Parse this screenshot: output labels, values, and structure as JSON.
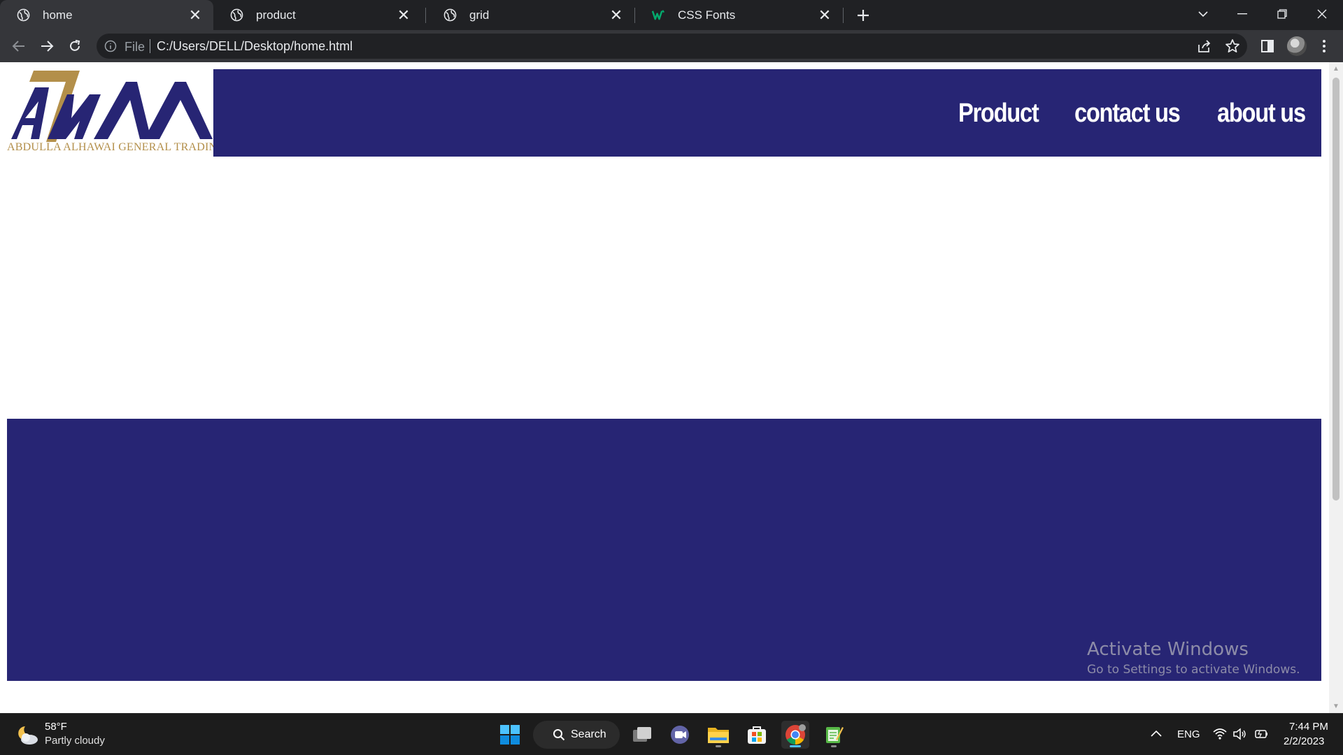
{
  "browser": {
    "tabs": [
      {
        "title": "home",
        "active": true,
        "icon": "globe-icon"
      },
      {
        "title": "product",
        "active": false,
        "icon": "globe-icon"
      },
      {
        "title": "grid",
        "active": false,
        "icon": "globe-icon"
      },
      {
        "title": "CSS Fonts",
        "active": false,
        "icon": "w3schools-icon"
      }
    ],
    "address": {
      "scheme_label": "File",
      "url": "C:/Users/DELL/Desktop/home.html"
    }
  },
  "page": {
    "logo": {
      "tagline": "ABDULLA ALHAWAI GENERAL TRADING",
      "brand_color": "#b38f4a",
      "mark_color": "#272574"
    },
    "nav": [
      {
        "label": "Product"
      },
      {
        "label": "contact us"
      },
      {
        "label": "about us"
      }
    ],
    "colors": {
      "header_bg": "#272574",
      "footer_bg": "#272574"
    },
    "watermark": {
      "title": "Activate Windows",
      "subtitle": "Go to Settings to activate Windows."
    }
  },
  "taskbar": {
    "weather": {
      "temp": "58°F",
      "condition": "Partly cloudy"
    },
    "search_label": "Search",
    "language": "ENG",
    "time": "7:44 PM",
    "date": "2/2/2023"
  }
}
